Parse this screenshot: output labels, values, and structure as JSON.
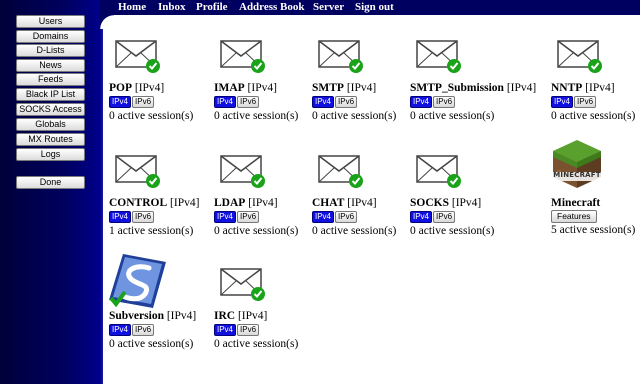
{
  "sidebar": {
    "items": [
      {
        "label": "Users"
      },
      {
        "label": "Domains"
      },
      {
        "label": "D-Lists"
      },
      {
        "label": "News"
      },
      {
        "label": "Feeds"
      },
      {
        "label": "Black IP List"
      },
      {
        "label": "SOCKS Access"
      },
      {
        "label": "Globals"
      },
      {
        "label": "MX Routes"
      },
      {
        "label": "Logs"
      }
    ],
    "done_label": "Done"
  },
  "topnav": {
    "links": [
      {
        "label": "Home"
      },
      {
        "label": "Inbox"
      },
      {
        "label": "Profile"
      },
      {
        "label": "Address Book"
      },
      {
        "label": "Server"
      },
      {
        "label": "Sign out"
      }
    ]
  },
  "services": [
    {
      "name": "POP",
      "ipv": "[IPv4]",
      "ipv4": "IPv4",
      "ipv6": "IPv6",
      "sessions": "0 active session(s)",
      "icon": "envelope-icon"
    },
    {
      "name": "IMAP",
      "ipv": "[IPv4]",
      "ipv4": "IPv4",
      "ipv6": "IPv6",
      "sessions": "0 active session(s)",
      "icon": "envelope-icon"
    },
    {
      "name": "SMTP",
      "ipv": "[IPv4]",
      "ipv4": "IPv4",
      "ipv6": "IPv6",
      "sessions": "0 active session(s)",
      "icon": "envelope-icon"
    },
    {
      "name": "SMTP_Submission",
      "ipv": "[IPv4]",
      "ipv4": "IPv4",
      "ipv6": "IPv6",
      "sessions": "0 active session(s)",
      "icon": "envelope-icon"
    },
    {
      "name": "NNTP",
      "ipv": "[IPv4]",
      "ipv4": "IPv4",
      "ipv6": "IPv6",
      "sessions": "0 active session(s)",
      "icon": "envelope-icon"
    },
    {
      "name": "CONTROL",
      "ipv": "[IPv4]",
      "ipv4": "IPv4",
      "ipv6": "IPv6",
      "sessions": "1 active session(s)",
      "icon": "envelope-icon"
    },
    {
      "name": "LDAP",
      "ipv": "[IPv4]",
      "ipv4": "IPv4",
      "ipv6": "IPv6",
      "sessions": "0 active session(s)",
      "icon": "envelope-icon"
    },
    {
      "name": "CHAT",
      "ipv": "[IPv4]",
      "ipv4": "IPv4",
      "ipv6": "IPv6",
      "sessions": "0 active session(s)",
      "icon": "envelope-icon"
    },
    {
      "name": "SOCKS",
      "ipv": "[IPv4]",
      "ipv4": "IPv4",
      "ipv6": "IPv6",
      "sessions": "0 active session(s)",
      "icon": "envelope-icon"
    },
    {
      "name": "Minecraft",
      "features_label": "Features",
      "logo_text": "MINECRAFT",
      "sessions": "5 active session(s)",
      "icon": "minecraft-grass-block-icon"
    },
    {
      "name": "Subversion",
      "ipv": "[IPv4]",
      "ipv4": "IPv4",
      "ipv6": "IPv6",
      "sessions": "0 active session(s)",
      "icon": "subversion-logo-icon"
    },
    {
      "name": "IRC",
      "ipv": "[IPv4]",
      "ipv4": "IPv4",
      "ipv6": "IPv6",
      "sessions": "0 active session(s)",
      "icon": "envelope-icon"
    }
  ],
  "colors": {
    "navy": "#000060",
    "ipv4_active": "#1010e0",
    "check_green": "#1aa31a"
  }
}
